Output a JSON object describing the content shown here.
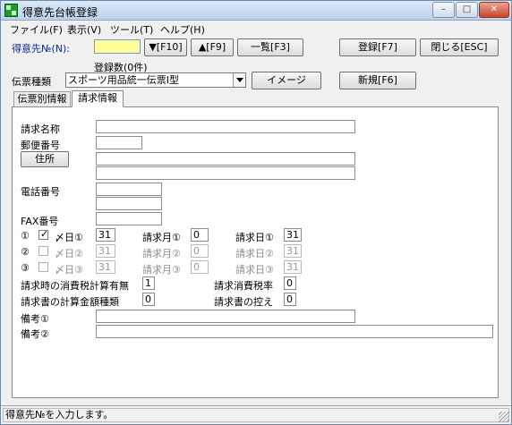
{
  "window": {
    "title": "得意先台帳登録",
    "controls": [
      "–",
      "□",
      "✕"
    ]
  },
  "menu": [
    {
      "label": "ファイル(F)"
    },
    {
      "label": "表示(V)"
    },
    {
      "label": "ツール(T)"
    },
    {
      "label": "ヘルプ(H)"
    }
  ],
  "toolbar": {
    "customer_no_label": "得意先№(N):",
    "customer_no_value": "",
    "btn_next": "▼[F10]",
    "btn_prev": "▲[F9]",
    "btn_list": "一覧[F3]",
    "btn_register": "登録[F7]",
    "btn_close": "閉じる[ESC]",
    "registered_count": "登録数(0件)",
    "slip_type_label": "伝票種類",
    "slip_type_value": "スポーツ用品統一伝票Ⅰ型",
    "btn_image": "イメージ",
    "btn_new": "新規[F6]"
  },
  "tabs": [
    {
      "label": "伝票別情報",
      "active": false
    },
    {
      "label": "請求情報",
      "active": true
    }
  ],
  "billing": {
    "billing_name_label": "請求名称",
    "billing_name_value": "",
    "postal_label": "郵便番号",
    "postal_value": "",
    "address_button": "住所",
    "address1_value": "",
    "address2_value": "",
    "phone_label": "電話番号",
    "phone1_value": "",
    "phone2_value": "",
    "fax_label": "FAX番号",
    "fax_value": "",
    "rows": [
      {
        "num": "①",
        "checked": true,
        "end_label": "〆日①",
        "end_value": "31",
        "month_label": "請求月①",
        "month_value": "0",
        "day_label": "請求日①",
        "day_value": "31"
      },
      {
        "num": "②",
        "checked": false,
        "end_label": "〆日②",
        "end_value": "31",
        "month_label": "請求月②",
        "month_value": "0",
        "day_label": "請求日②",
        "day_value": "31"
      },
      {
        "num": "③",
        "checked": false,
        "end_label": "〆日③",
        "end_value": "31",
        "month_label": "請求月③",
        "month_value": "0",
        "day_label": "請求日③",
        "day_value": "31"
      }
    ],
    "tax_calc_label": "請求時の消費税計算有無",
    "tax_calc_value": "1",
    "tax_rate_label": "請求消費税率",
    "tax_rate_value": "0",
    "amount_type_label": "請求書の計算金額種類",
    "amount_type_value": "0",
    "invoice_copy_label": "請求書の控え",
    "invoice_copy_value": "0",
    "note1_label": "備考①",
    "note1_value": "",
    "note2_label": "備考②",
    "note2_value": ""
  },
  "status": {
    "message": "得意先№を入力します。"
  }
}
